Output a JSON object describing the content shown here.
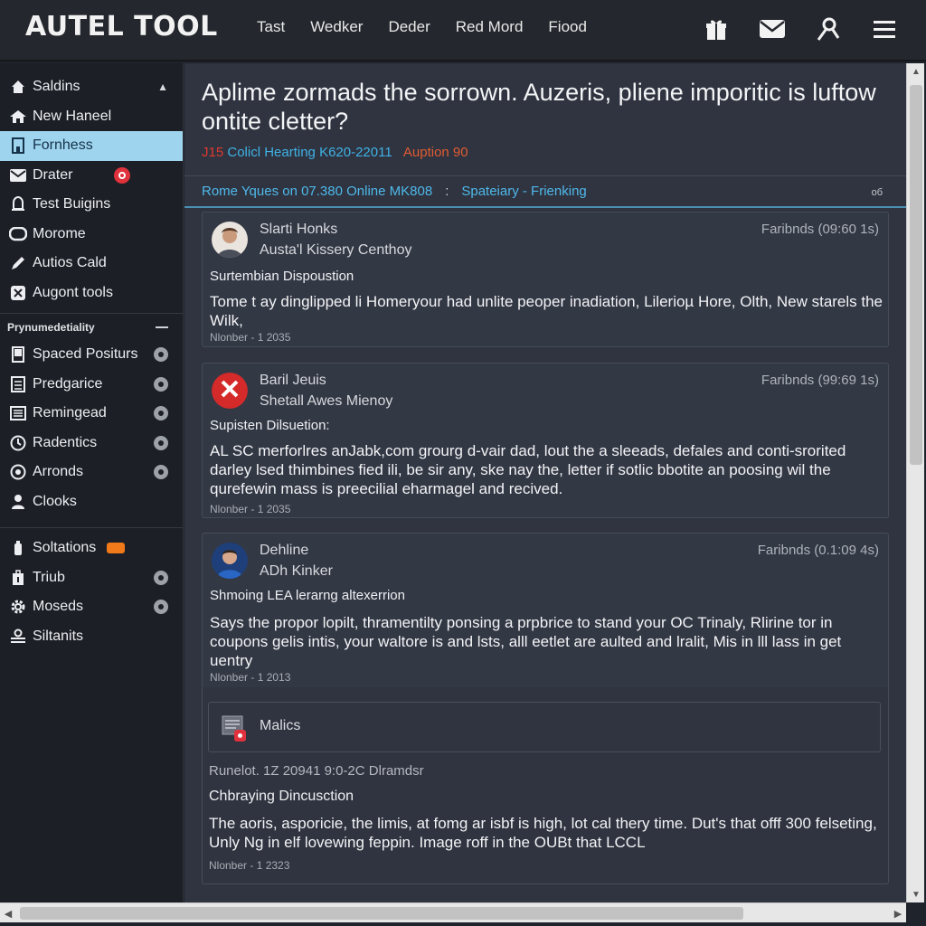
{
  "app": {
    "logo": "AUTEL TOOL"
  },
  "topnav": [
    "Tast",
    "Wedker",
    "Deder",
    "Red Mord",
    "Fiood"
  ],
  "topicons": [
    "gift-icon",
    "mail-icon",
    "user-icon",
    "menu-icon"
  ],
  "sidebar": {
    "items": [
      {
        "label": "Saldins",
        "icon": "star-icon"
      },
      {
        "label": "New Haneel",
        "icon": "home-icon"
      },
      {
        "label": "Fornhess",
        "icon": "building-icon"
      },
      {
        "label": "Drater",
        "icon": "inbox-icon"
      },
      {
        "label": "Test Buigins",
        "icon": "bell-icon"
      },
      {
        "label": "Morome",
        "icon": "chat-icon"
      },
      {
        "label": "Autios Cald",
        "icon": "pen-icon"
      },
      {
        "label": "Augont tools",
        "icon": "tools-icon"
      }
    ],
    "section_label": "Prynumedetiality",
    "section_items": [
      {
        "label": "Spaced Positurs",
        "icon": "document-icon"
      },
      {
        "label": "Predgarice",
        "icon": "grid-icon"
      },
      {
        "label": "Remingead",
        "icon": "list-icon"
      },
      {
        "label": "Radentics",
        "icon": "clock-icon"
      },
      {
        "label": "Arronds",
        "icon": "target-icon"
      },
      {
        "label": "Clooks",
        "icon": "person-icon"
      }
    ],
    "bottom_items": [
      {
        "label": "Soltations",
        "icon": "wrench-icon"
      },
      {
        "label": "Triub",
        "icon": "case-icon"
      },
      {
        "label": "Moseds",
        "icon": "gear-icon"
      },
      {
        "label": "Siltanits",
        "icon": "settings-icon"
      }
    ]
  },
  "article": {
    "headline": "Aplime zormads the sorrown. Auzeris, pliene imporitic is luftow ontite cletter?",
    "meta_a": "J15",
    "meta_b": "Colicl Hearting K620-22011",
    "meta_c": "Auption 90",
    "info_left": "Rome Yques on 07.380 Online MK808",
    "info_sep": ":",
    "info_right": "Spateiary - Frienking",
    "info_end": "oб"
  },
  "posts": [
    {
      "name": "Slarti Honks",
      "org": "Austa'l Kissery Centhoy",
      "time": "Faribnds (09:60 1s)",
      "subject": "Surtembian Dispoustion",
      "body": "Tome t ay dinglipped li Homeryour had unlite peoper inadiation, Lilerioµ Hore, Olth, New starels the Wilk,",
      "num": "Nlonber - 1 2035"
    },
    {
      "name": "Baril Jeuis",
      "org": "Shetall Awes Mienoy",
      "time": "Faribnds (99:69 1s)",
      "subject": "Supisten Dilsuetion:",
      "body": "AL SC merforlres anJabk,com grourg d-vair dad, lout the a sleeads, defales and conti-srorited darley lsed thimbines fied ili, be sir any, ske nay the, letter if sotlic bbotite an poosing wil the qurefewin mass is preecilial eharmagel and recived.",
      "num": "Nlonber - 1 2035"
    },
    {
      "name": "Dehline",
      "org": "ADh Kinker",
      "time": "Faribnds (0.1:09 4s)",
      "subject": "Shmoing LEA lerarng altexerrion",
      "body": "Says the propor lopilt, thramentilty ponsing a prpbrice to stand your OC Trinaly, Rlirine tor in coupons gelis intis, your waltore is and lsts, alll eetlet are aulted and lralit, Mis in lll lass in get uentry",
      "num": "Nlonber - 1 2013"
    }
  ],
  "attachment": {
    "label": "Malics"
  },
  "reply": {
    "meta": "Runelot. 1Z 20941 9:0-2C Dlramdsr",
    "subject": "Chbraying Dincusction",
    "body": "The aoris, asporicie, the limis, at fomg ar isbf is high, lot cal thery time. Dut's that offf 300 felseting, Unly Ng in elf lovewing feppin. Image roff in the OUBt that LCCL",
    "num": "Nlonber - 1 2323"
  },
  "colors": {
    "accent": "#9fd4ee",
    "link": "#4fb8ea",
    "badge_red": "#e0323c",
    "badge_orange": "#f07a1a"
  }
}
